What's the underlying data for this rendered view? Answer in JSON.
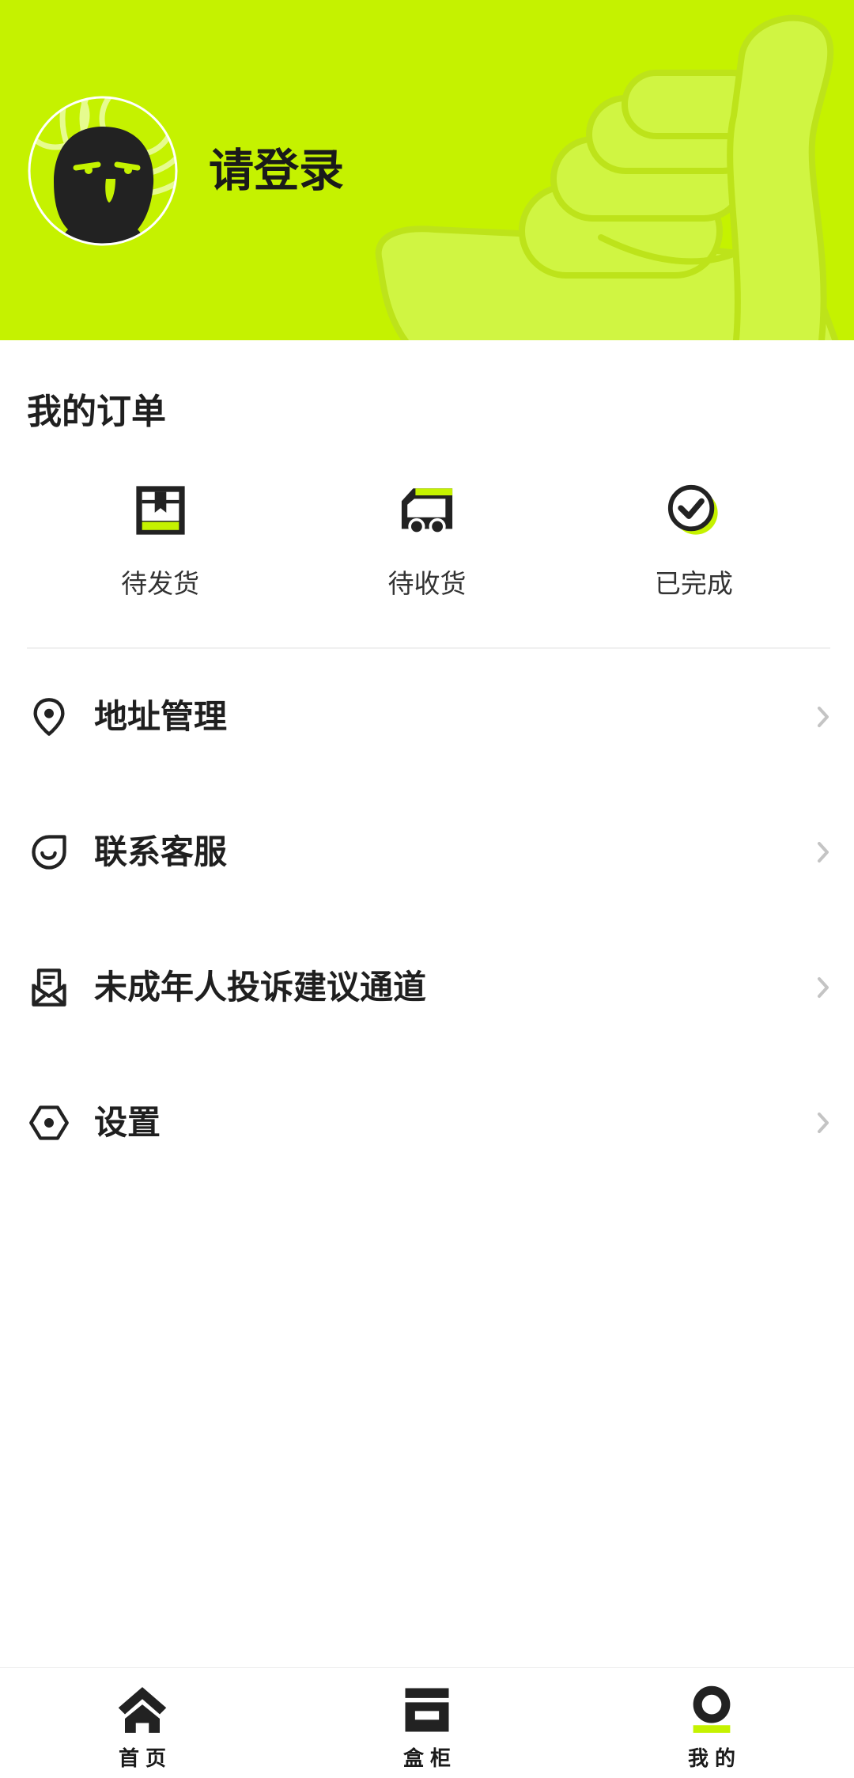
{
  "colors": {
    "accent": "#c5f200",
    "hand_fill": "#d0f542",
    "hand_stroke": "#bde31a",
    "text": "#1f1f1f",
    "chevron": "#c4c4c4",
    "divider": "#f0f0f0"
  },
  "profile": {
    "avatar_icon": "avatar-mascot-icon",
    "decoration_icon": "thumbs-up-hand-icon",
    "login_prompt": "请登录"
  },
  "orders": {
    "title": "我的订单",
    "items": [
      {
        "label": "待发货",
        "icon": "box-icon"
      },
      {
        "label": "待收货",
        "icon": "truck-icon"
      },
      {
        "label": "已完成",
        "icon": "check-circle-icon"
      }
    ]
  },
  "menu": {
    "chevron_icon": "chevron-right-icon",
    "items": [
      {
        "label": "地址管理",
        "icon": "location-pin-icon"
      },
      {
        "label": "联系客服",
        "icon": "customer-service-icon"
      },
      {
        "label": "未成年人投诉建议通道",
        "icon": "complaint-mail-icon"
      },
      {
        "label": "设置",
        "icon": "settings-icon"
      }
    ]
  },
  "tabbar": {
    "items": [
      {
        "label": "首页",
        "icon": "home-icon",
        "active": false
      },
      {
        "label": "盒柜",
        "icon": "cabinet-icon",
        "active": false
      },
      {
        "label": "我的",
        "icon": "profile-icon",
        "active": true
      }
    ]
  }
}
